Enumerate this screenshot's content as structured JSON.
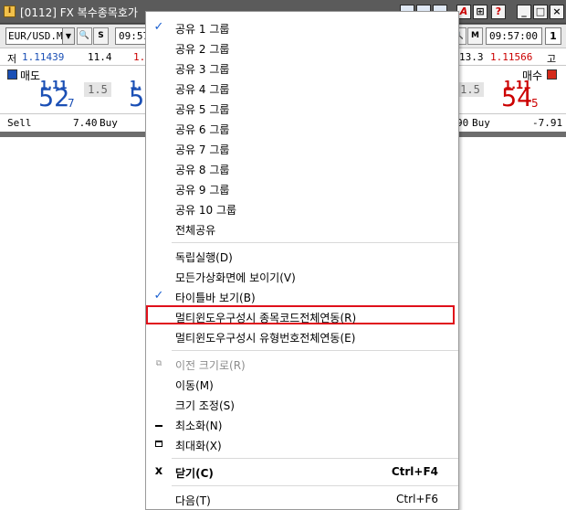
{
  "window": {
    "title": "[0112] FX 복수종목호가",
    "app_icon": "I",
    "title_buttons": [
      "?",
      "_",
      "□",
      "×"
    ],
    "toolbar": {
      "symbol": "EUR/USD.M",
      "time_left": "09:57",
      "time_right": "09:57:00",
      "s_label": "S",
      "m_label": "M",
      "count": "1"
    },
    "info_row": {
      "low_label": "저",
      "low_value": "1.11439",
      "mid_value": "11.4",
      "mid_trunc": "1.",
      "right_value": "13.3",
      "high_value": "1.11566",
      "high_label": "고"
    },
    "quote_row": {
      "sell_label": "매도",
      "buy_label": "매수",
      "sell_big_prefix": "1.11",
      "sell_big": "52",
      "sell_small": "7",
      "sell_trunc_prefix": "1.",
      "sell_trunc": "5",
      "spread_left": "1.5",
      "spread_right": "1.5",
      "buy_big_prefix": "1.11",
      "buy_big": "54",
      "buy_small": "5"
    },
    "trade_row": {
      "sell_text": "Sell",
      "sell_value": "7.40",
      "buy_text": "Buy",
      "right_prefix": "90",
      "right_buy": "Buy",
      "right_value": "-7.91"
    }
  },
  "menu": {
    "groups": [
      {
        "label": "공유 1 그룹",
        "checked": true
      },
      {
        "label": "공유 2 그룹",
        "checked": false
      },
      {
        "label": "공유 3 그룹",
        "checked": false
      },
      {
        "label": "공유 4 그룹",
        "checked": false
      },
      {
        "label": "공유 5 그룹",
        "checked": false
      },
      {
        "label": "공유 6 그룹",
        "checked": false
      },
      {
        "label": "공유 7 그룹",
        "checked": false
      },
      {
        "label": "공유 8 그룹",
        "checked": false
      },
      {
        "label": "공유 9 그룹",
        "checked": false
      },
      {
        "label": "공유 10 그룹",
        "checked": false
      },
      {
        "label": "전체공유",
        "checked": false
      }
    ],
    "options": [
      {
        "label": "독립실행(D)",
        "checked": false
      },
      {
        "label": "모든가상화면에 보이기(V)",
        "checked": false
      },
      {
        "label": "타이틀바 보기(B)",
        "checked": true
      },
      {
        "label": "멀티윈도우구성시 종목코드전체연동(R)",
        "checked": false,
        "highlighted": true
      },
      {
        "label": "멀티윈도우구성시 유형번호전체연동(E)",
        "checked": false
      }
    ],
    "system": [
      {
        "label": "이전 크기로(R)",
        "icon": "restore-icon",
        "disabled": true
      },
      {
        "label": "이동(M)",
        "icon": "",
        "disabled": false
      },
      {
        "label": "크기 조정(S)",
        "icon": "",
        "disabled": false
      },
      {
        "label": "최소화(N)",
        "icon": "minimize-icon",
        "disabled": false
      },
      {
        "label": "최대화(X)",
        "icon": "maximize-icon",
        "disabled": false
      }
    ],
    "close": {
      "label": "닫기(C)",
      "shortcut": "Ctrl+F4",
      "icon": "x"
    },
    "next": {
      "label": "다음(T)",
      "shortcut": "Ctrl+F6"
    },
    "check_glyph": "✓",
    "highlight_color": "#e0101a"
  }
}
